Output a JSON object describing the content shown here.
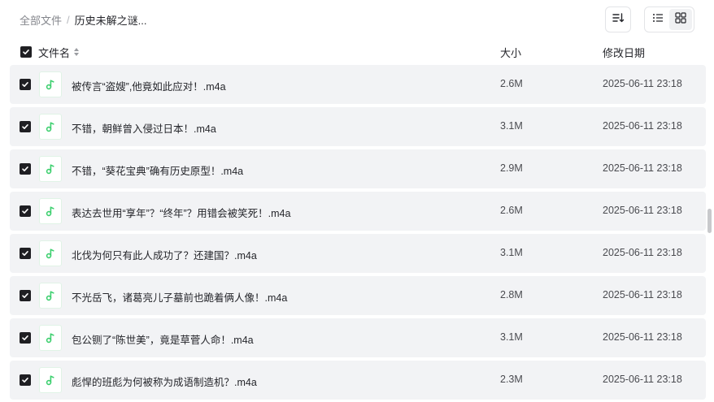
{
  "breadcrumb": {
    "root": "全部文件",
    "separator": "/",
    "current": "历史未解之谜..."
  },
  "toolbar": {
    "sort_icon": "sort-icon",
    "view_list_icon": "list-view-icon",
    "view_grid_icon": "grid-view-icon",
    "active_view": "list"
  },
  "table": {
    "headers": {
      "name": "文件名",
      "size": "大小",
      "modified": "修改日期"
    },
    "all_selected": true,
    "rows": [
      {
        "name": "被传言“盗嫂”,他竟如此应对！.m4a",
        "size": "2.6M",
        "modified": "2025-06-11 23:18",
        "selected": true
      },
      {
        "name": "不错，朝鲜曾入侵过日本！.m4a",
        "size": "3.1M",
        "modified": "2025-06-11 23:18",
        "selected": true
      },
      {
        "name": "不错，“葵花宝典”确有历史原型！.m4a",
        "size": "2.9M",
        "modified": "2025-06-11 23:18",
        "selected": true
      },
      {
        "name": "表达去世用“享年”？“终年”？用错会被笑死！.m4a",
        "size": "2.6M",
        "modified": "2025-06-11 23:18",
        "selected": true
      },
      {
        "name": "北伐为何只有此人成功了？还建国？.m4a",
        "size": "3.1M",
        "modified": "2025-06-11 23:18",
        "selected": true
      },
      {
        "name": "不光岳飞，诸葛亮儿子墓前也跪着俩人像！.m4a",
        "size": "2.8M",
        "modified": "2025-06-11 23:18",
        "selected": true
      },
      {
        "name": "包公铡了“陈世美”，竟是草菅人命！.m4a",
        "size": "3.1M",
        "modified": "2025-06-11 23:18",
        "selected": true
      },
      {
        "name": "彪悍的班彪为何被称为成语制造机？.m4a",
        "size": "2.3M",
        "modified": "2025-06-11 23:18",
        "selected": true
      }
    ]
  },
  "colors": {
    "audio_icon": "#3ccf6e",
    "row_background": "#f2f3f5",
    "checkbox": "#1f1f23"
  }
}
